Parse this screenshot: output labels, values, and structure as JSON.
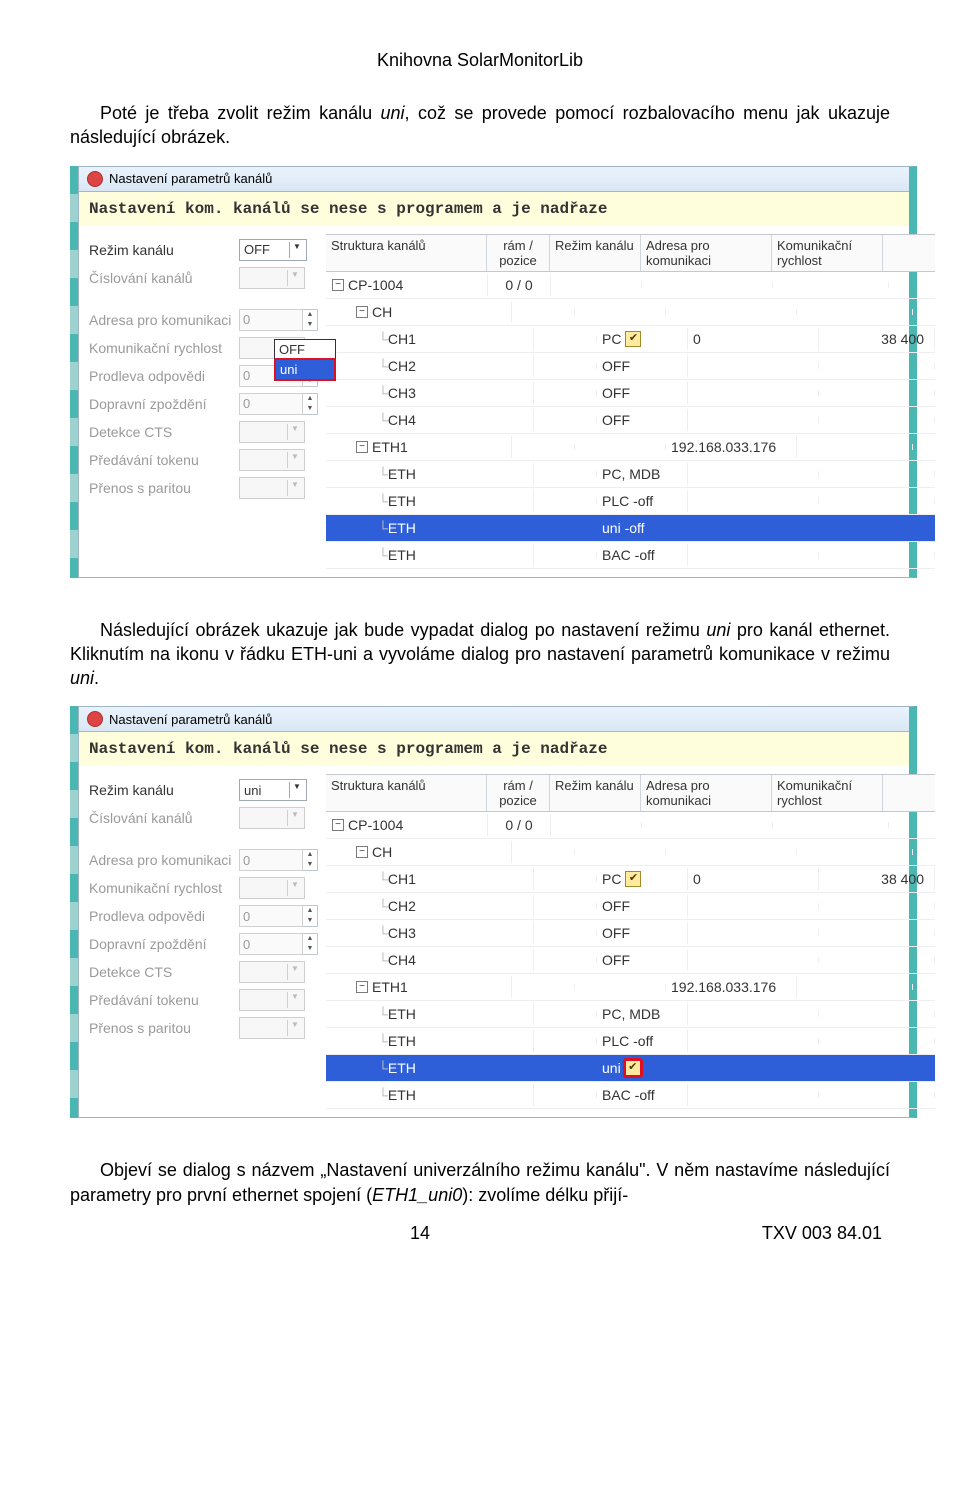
{
  "doc": {
    "header": "Knihovna SolarMonitorLib",
    "para1_a": "Poté je třeba zvolit režim kanálu ",
    "para1_i": "uni",
    "para1_b": ", což se provede pomocí rozbalovacího menu jak ukazuje následující obrázek.",
    "para2_a": "Následující obrázek ukazuje jak bude vypadat dialog po nastavení režimu ",
    "para2_i": "uni",
    "para2_b": " pro kanál ethernet. Kliknutím na ikonu v řádku ETH-uni a vyvoláme dialog pro nastavení parametrů komunikace v režimu ",
    "para2_i2": "uni",
    "para2_c": ".",
    "para3_a": "Objeví se dialog s názvem „Nastavení univerzálního režimu kanálu\". V něm nastavíme následující parametry pro první ethernet spojení (",
    "para3_i": "ETH1_uni0",
    "para3_b": "): zvolíme délku přijí-",
    "page_num": "14",
    "page_code": "TXV 003 84.01"
  },
  "shot": {
    "title_bar": "Nastavení parametrů kanálů",
    "banner": "Nastavení kom. kanálů se nese s programem a je nadřaze",
    "left_labels": {
      "rezim": "Režim kanálu",
      "cislovani": "Číslování kanálů",
      "adresa": "Adresa pro komunikaci",
      "rychlost": "Komunikační rychlost",
      "prodleva": "Prodleva odpovědi",
      "zpozdeni": "Dopravní zpoždění",
      "detekce": "Detekce CTS",
      "token": "Předávání tokenu",
      "parita": "Přenos s paritou"
    },
    "values": {
      "adresa": "0",
      "prodleva": "0",
      "zpozdeni": "0"
    },
    "popup": {
      "item0": "OFF",
      "item1": "uni"
    },
    "headers": {
      "c0": "Struktura kanálů",
      "c1": "rám / pozice",
      "c2": "Režim kanálu",
      "c3": "Adresa pro komunikaci",
      "c4": "Komunikační rychlost"
    }
  },
  "shot1": {
    "rezim_value": "OFF",
    "rows": [
      {
        "c0": "CP-1004",
        "c1": "0 / 0",
        "c2": "",
        "c3": "",
        "c4": "",
        "lvl": 1,
        "box": "−"
      },
      {
        "c0": "CH",
        "c1": "",
        "c2": "",
        "c3": "",
        "c4": "",
        "lvl": 2,
        "box": "−"
      },
      {
        "c0": "CH1",
        "c1": "",
        "c2": "PC",
        "c3": "0",
        "c4": "38 400",
        "lvl": 3,
        "chk": true
      },
      {
        "c0": "CH2",
        "c1": "",
        "c2": "OFF",
        "c3": "",
        "c4": "",
        "lvl": 3
      },
      {
        "c0": "CH3",
        "c1": "",
        "c2": "OFF",
        "c3": "",
        "c4": "",
        "lvl": 3
      },
      {
        "c0": "CH4",
        "c1": "",
        "c2": "OFF",
        "c3": "",
        "c4": "",
        "lvl": 3
      },
      {
        "c0": "ETH1",
        "c1": "",
        "c2": "",
        "c3": "192.168.033.176",
        "c4": "",
        "lvl": 2,
        "box": "−"
      },
      {
        "c0": "ETH",
        "c1": "",
        "c2": "PC, MDB",
        "c3": "",
        "c4": "",
        "lvl": 3
      },
      {
        "c0": "ETH",
        "c1": "",
        "c2": "PLC -off",
        "c3": "",
        "c4": "",
        "lvl": 3
      },
      {
        "c0": "ETH",
        "c1": "",
        "c2": "uni -off",
        "c3": "",
        "c4": "",
        "lvl": 3,
        "sel": true
      },
      {
        "c0": "ETH",
        "c1": "",
        "c2": "BAC -off",
        "c3": "",
        "c4": "",
        "lvl": 3
      }
    ]
  },
  "shot2": {
    "rezim_value": "uni",
    "rows": [
      {
        "c0": "CP-1004",
        "c1": "0 / 0",
        "c2": "",
        "c3": "",
        "c4": "",
        "lvl": 1,
        "box": "−"
      },
      {
        "c0": "CH",
        "c1": "",
        "c2": "",
        "c3": "",
        "c4": "",
        "lvl": 2,
        "box": "−"
      },
      {
        "c0": "CH1",
        "c1": "",
        "c2": "PC",
        "c3": "0",
        "c4": "38 400",
        "lvl": 3,
        "chk": true
      },
      {
        "c0": "CH2",
        "c1": "",
        "c2": "OFF",
        "c3": "",
        "c4": "",
        "lvl": 3
      },
      {
        "c0": "CH3",
        "c1": "",
        "c2": "OFF",
        "c3": "",
        "c4": "",
        "lvl": 3
      },
      {
        "c0": "CH4",
        "c1": "",
        "c2": "OFF",
        "c3": "",
        "c4": "",
        "lvl": 3
      },
      {
        "c0": "ETH1",
        "c1": "",
        "c2": "",
        "c3": "192.168.033.176",
        "c4": "",
        "lvl": 2,
        "box": "−"
      },
      {
        "c0": "ETH",
        "c1": "",
        "c2": "PC, MDB",
        "c3": "",
        "c4": "",
        "lvl": 3
      },
      {
        "c0": "ETH",
        "c1": "",
        "c2": "PLC -off",
        "c3": "",
        "c4": "",
        "lvl": 3
      },
      {
        "c0": "ETH",
        "c1": "",
        "c2": "uni",
        "c3": "",
        "c4": "",
        "lvl": 3,
        "sel": true,
        "chk": true,
        "redchk": true
      },
      {
        "c0": "ETH",
        "c1": "",
        "c2": "BAC -off",
        "c3": "",
        "c4": "",
        "lvl": 3
      }
    ]
  }
}
